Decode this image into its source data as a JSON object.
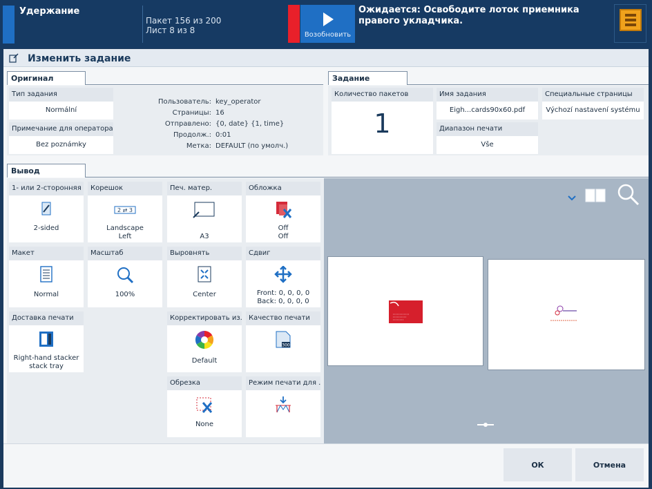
{
  "topbar": {
    "status": "Удержание",
    "batch": "Пакет 156 из 200",
    "sheet": "Лист 8 из 8",
    "resume_label": "Возобновить",
    "message": "Ожидается: Освободите лоток приемника правого укладчика.",
    "accent_color": "#1f6fc4",
    "alert_color": "#e8202a"
  },
  "title": "Изменить задание",
  "original": {
    "tab": "Оригинал",
    "job_type_label": "Тип задания",
    "job_type_value": "Normální",
    "operator_note_label": "Примечание для оператора",
    "operator_note_value": "Bez poznámky",
    "info": [
      {
        "k": "Пользователь:",
        "v": "key_operator"
      },
      {
        "k": "Страницы:",
        "v": "16"
      },
      {
        "k": "Отправлено:",
        "v": "{0, date} {1, time}"
      },
      {
        "k": "Продолж.:",
        "v": "0:01"
      },
      {
        "k": "Метка:",
        "v": "DEFAULT (по умолч.)"
      }
    ]
  },
  "job": {
    "tab": "Задание",
    "batches_label": "Количество пакетов",
    "batches_value": "1",
    "name_label": "Имя задания",
    "name_value": "Eigh...cards90x60.pdf",
    "special_label": "Специальные страницы",
    "special_value": "Výchozí nastavení systému",
    "range_label": "Диапазон печати",
    "range_value": "Vše"
  },
  "output": {
    "tab": "Вывод",
    "tiles": [
      {
        "label": "1- или 2-сторонняя",
        "t1": "2-sided",
        "t2": "",
        "icon": "duplex-icon"
      },
      {
        "label": "Корешок",
        "t1": "Landscape",
        "t2": "Left",
        "icon": "binding-icon"
      },
      {
        "label": "Печ. матер.",
        "t1": "A3",
        "t2": "",
        "icon": "media-icon"
      },
      {
        "label": "Обложка",
        "t1": "Off",
        "t2": "Off",
        "icon": "cover-icon"
      },
      {
        "label": "Макет",
        "t1": "Normal",
        "t2": "",
        "icon": "layout-icon"
      },
      {
        "label": "Масштаб",
        "t1": "100%",
        "t2": "",
        "icon": "zoom-icon"
      },
      {
        "label": "Выровнять",
        "t1": "Center",
        "t2": "",
        "icon": "align-icon"
      },
      {
        "label": "Сдвиг",
        "t1": "Front: 0, 0, 0, 0",
        "t2": "Back: 0, 0, 0, 0",
        "icon": "shift-icon"
      },
      {
        "label": "Доставка печати",
        "t1": "Right-hand stacker",
        "t2": "stack tray",
        "icon": "stacker-icon"
      },
      {
        "label": "Корректировать из...",
        "t1": "Default",
        "t2": "",
        "icon": "color-wheel-icon"
      },
      {
        "label": "Качество печати",
        "t1": "",
        "t2": "",
        "icon": "quality-icon"
      },
      {
        "label": "Обрезка",
        "t1": "None",
        "t2": "",
        "icon": "trim-icon"
      },
      {
        "label": "Режим печати для ...",
        "t1": "",
        "t2": "",
        "icon": "print-mode-icon"
      }
    ]
  },
  "footer": {
    "ok": "ОК",
    "cancel": "Отмена"
  }
}
